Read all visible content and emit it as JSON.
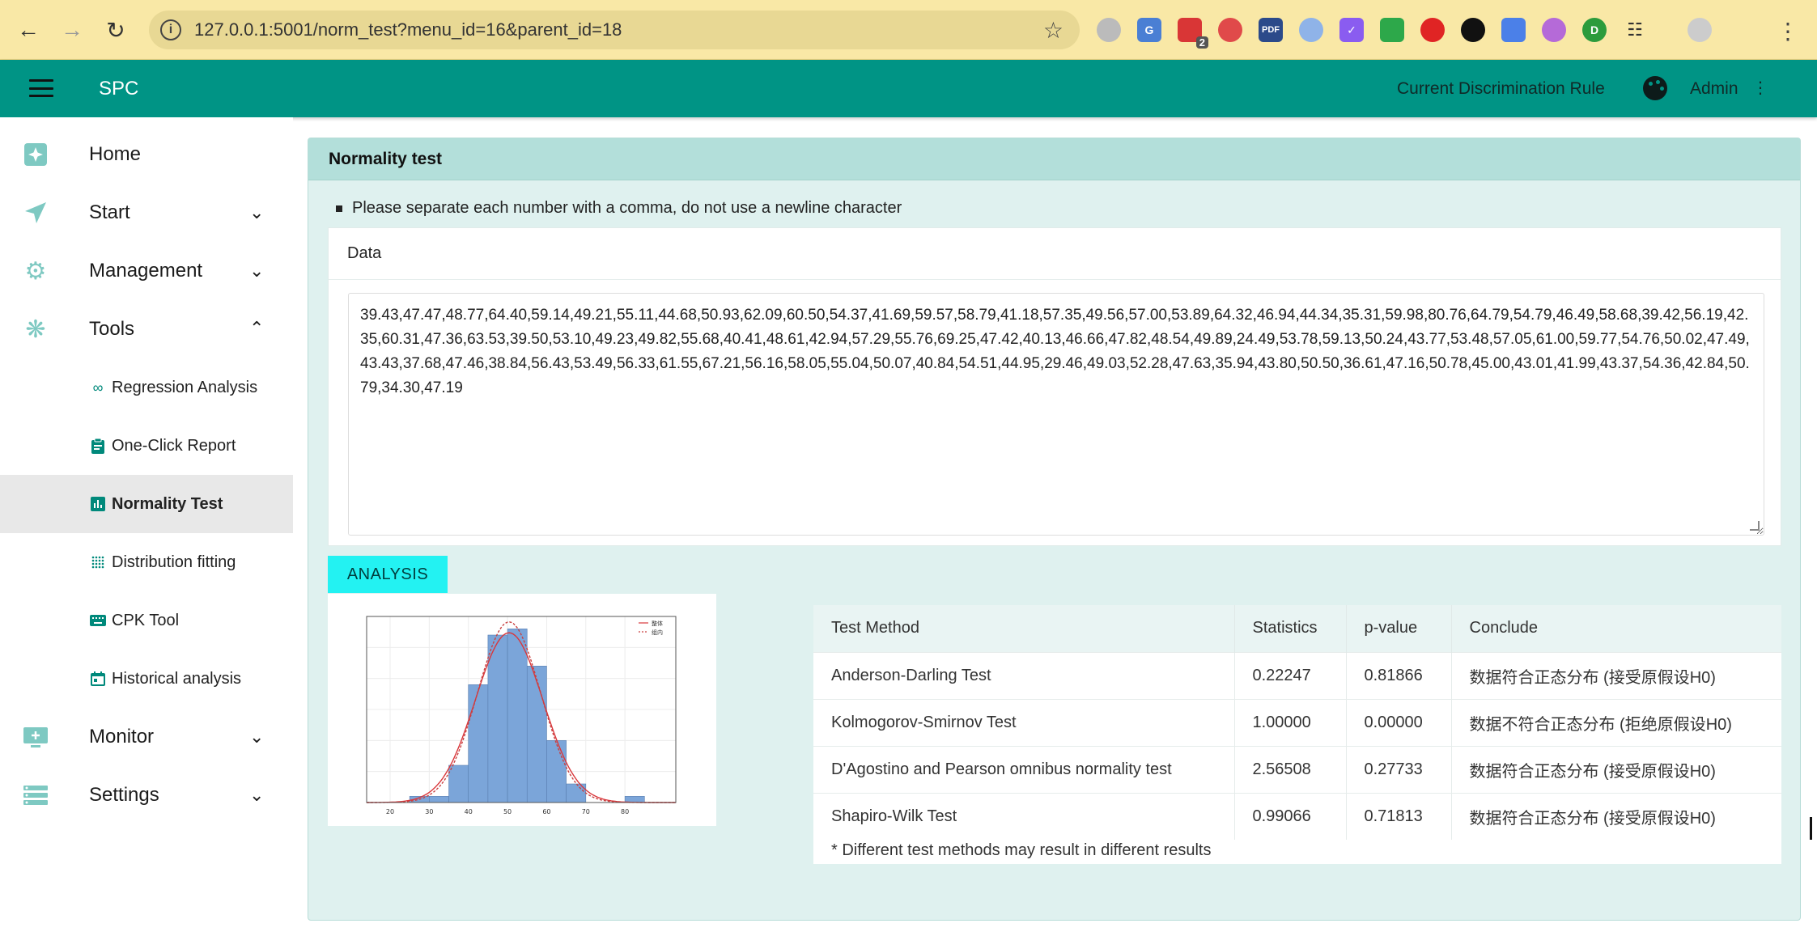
{
  "browser": {
    "url": "127.0.0.1:5001/norm_test?menu_id=16&parent_id=18",
    "extension_badge": "2",
    "pdf_label": "PDF"
  },
  "header": {
    "title": "SPC",
    "rule_link": "Current Discrimination Rule",
    "user": "Admin"
  },
  "sidebar": {
    "items": [
      {
        "label": "Home",
        "icon": "home-icon"
      },
      {
        "label": "Start",
        "icon": "send-icon"
      },
      {
        "label": "Management",
        "icon": "gear-icon"
      },
      {
        "label": "Tools",
        "icon": "tools-icon"
      },
      {
        "label": "Monitor",
        "icon": "monitor-icon"
      },
      {
        "label": "Settings",
        "icon": "settings-list-icon"
      }
    ],
    "sub_items": [
      {
        "label": "Regression Analysis",
        "icon": "infinity-icon"
      },
      {
        "label": "One-Click Report",
        "icon": "clipboard-icon"
      },
      {
        "label": "Normality Test",
        "icon": "bar-chart-icon"
      },
      {
        "label": "Distribution fitting",
        "icon": "grid-dots-icon"
      },
      {
        "label": "CPK Tool",
        "icon": "keyboard-icon"
      },
      {
        "label": "Historical analysis",
        "icon": "calendar-icon"
      }
    ],
    "active": "Normality Test"
  },
  "main": {
    "panel_title": "Normality test",
    "hint": "Please separate each number with a comma, do not use a newline character",
    "data_label": "Data",
    "data_value": "39.43,47.47,48.77,64.40,59.14,49.21,55.11,44.68,50.93,62.09,60.50,54.37,41.69,59.57,58.79,41.18,57.35,49.56,57.00,53.89,64.32,46.94,44.34,35.31,59.98,80.76,64.79,54.79,46.49,58.68,39.42,56.19,42.35,60.31,47.36,63.53,39.50,53.10,49.23,49.82,55.68,40.41,48.61,42.94,57.29,55.76,69.25,47.42,40.13,46.66,47.82,48.54,49.89,24.49,53.78,59.13,50.24,43.77,53.48,57.05,61.00,59.77,54.76,50.02,47.49,43.43,37.68,47.46,38.84,56.43,53.49,56.33,61.55,67.21,56.16,58.05,55.04,50.07,40.84,54.51,44.95,29.46,49.03,52.28,47.63,35.94,43.80,50.50,36.61,47.16,50.78,45.00,43.01,41.99,43.37,54.36,42.84,50.79,34.30,47.19",
    "analyze_label": "ANALYSIS",
    "table": {
      "headers": [
        "Test Method",
        "Statistics",
        "p-value",
        "Conclude"
      ],
      "rows": [
        [
          "Anderson-Darling Test",
          "0.22247",
          "0.81866",
          "数据符合正态分布 (接受原假设H0)"
        ],
        [
          "Kolmogorov-Smirnov Test",
          "1.00000",
          "0.00000",
          "数据不符合正态分布 (拒绝原假设H0)"
        ],
        [
          "D'Agostino and Pearson omnibus normality test",
          "2.56508",
          "0.27733",
          "数据符合正态分布 (接受原假设H0)"
        ],
        [
          "Shapiro-Wilk Test",
          "0.99066",
          "0.71813",
          "数据符合正态分布 (接受原假设H0)"
        ]
      ],
      "note": "* Different test methods may result in different results"
    }
  },
  "chart_data": {
    "type": "bar",
    "title": "",
    "xlabel": "",
    "ylabel": "",
    "x_ticks": [
      "20",
      "30",
      "40",
      "50",
      "60",
      "70",
      "80"
    ],
    "xlim": [
      14,
      93
    ],
    "bins": [
      [
        20,
        25
      ],
      [
        25,
        30
      ],
      [
        30,
        35
      ],
      [
        35,
        40
      ],
      [
        40,
        45
      ],
      [
        45,
        50
      ],
      [
        50,
        55
      ],
      [
        55,
        60
      ],
      [
        60,
        65
      ],
      [
        65,
        70
      ],
      [
        70,
        75
      ],
      [
        75,
        80
      ],
      [
        80,
        85
      ]
    ],
    "values": [
      0,
      1,
      1,
      6,
      19,
      27,
      28,
      22,
      10,
      3,
      0,
      0,
      1
    ],
    "ylim": [
      0,
      30
    ],
    "legend": [
      "整体",
      "组内"
    ],
    "legend_position": "top-right",
    "curve_colors": [
      "#d9373b",
      "#c94040"
    ],
    "bar_color": "#7ba5d9",
    "curve_mean": 50.4,
    "curve_sd": 8.6
  },
  "colors": {
    "accent": "#009485",
    "panel_bg": "#dff1ef",
    "panel_header": "#b3dfda",
    "analyze_button": "#23f2f2"
  }
}
